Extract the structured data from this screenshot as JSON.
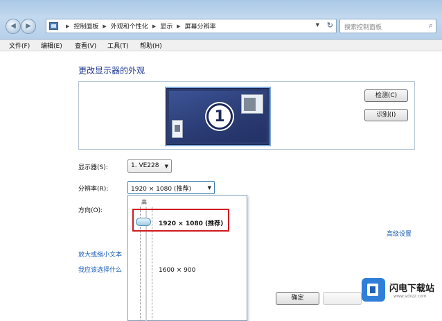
{
  "address_bar": {
    "breadcrumbs": [
      "控制面板",
      "外观和个性化",
      "显示",
      "屏幕分辨率"
    ],
    "search_placeholder": "搜索控制面板"
  },
  "menu": [
    "文件(F)",
    "编辑(E)",
    "查看(V)",
    "工具(T)",
    "帮助(H)"
  ],
  "page": {
    "title": "更改显示器的外观",
    "monitor_number": "1",
    "detect_label": "检测(C)",
    "identify_label": "识别(I)"
  },
  "settings": {
    "display_label": "显示器(S):",
    "display_value": "1. VE228",
    "resolution_label": "分辨率(R):",
    "resolution_value": "1920 × 1080 (推荐)",
    "orientation_label": "方向(O):"
  },
  "resolution_popup": {
    "high_label": "高",
    "options": [
      "1920 × 1080 (推荐)",
      "1600 × 900"
    ],
    "selected_index": 0,
    "slider_fraction_from_top": 0.0
  },
  "links": {
    "advanced": "高级设置",
    "text_size": "放大或缩小文本",
    "help": "我应该选择什么"
  },
  "buttons": {
    "ok_label": "确定"
  },
  "watermark": {
    "brand": "闪电下载站",
    "url": "www.sdxzz.com"
  },
  "colors": {
    "highlight_border": "#d01a1f",
    "link": "#1d5fb8",
    "title": "#1f3a93"
  }
}
